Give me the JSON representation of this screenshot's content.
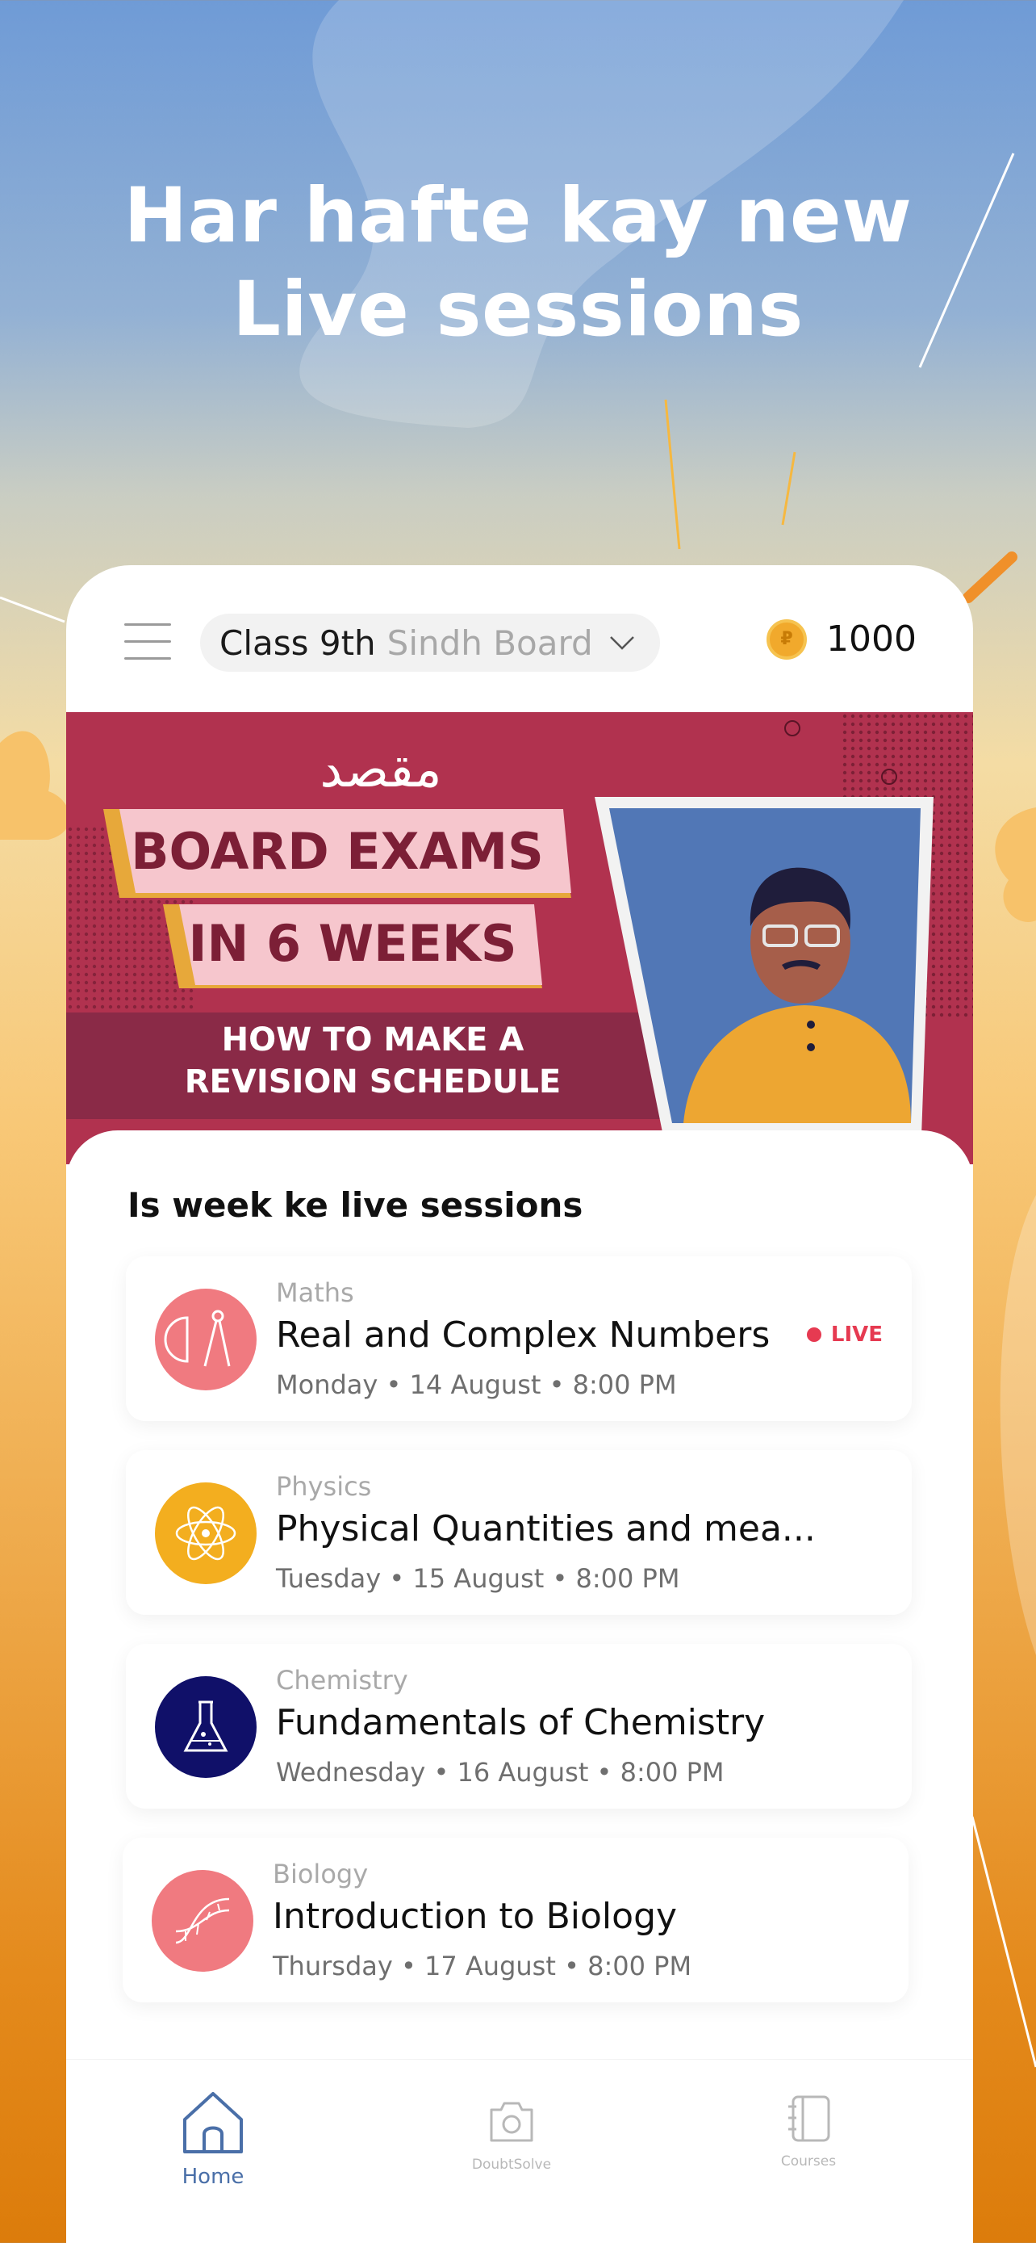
{
  "headline": {
    "line1": "Har hafte kay new",
    "line2": "Live sessions"
  },
  "header": {
    "class_label": "Class 9th",
    "board_label": "Sindh Board",
    "coin_count": "1000"
  },
  "banner": {
    "brand": "مقصد",
    "line1": "BOARD EXAMS",
    "line2": "IN 6 WEEKS",
    "sub1": "HOW TO MAKE A",
    "sub2": "REVISION SCHEDULE"
  },
  "sessions": {
    "section_title": "Is week ke live sessions",
    "items": [
      {
        "subject": "Maths",
        "title": "Real and Complex Numbers",
        "when": "Monday • 14 August • 8:00 PM",
        "live_label": "LIVE",
        "icon": "compass-protractor-icon",
        "color": "#f07a80"
      },
      {
        "subject": "Physics",
        "title": "Physical Quantities and mea...",
        "when": "Tuesday • 15 August • 8:00 PM",
        "icon": "atom-icon",
        "color": "#f3ae1f"
      },
      {
        "subject": "Chemistry",
        "title": "Fundamentals of Chemistry",
        "when": "Wednesday • 16 August • 8:00 PM",
        "icon": "flask-icon",
        "color": "#101069"
      },
      {
        "subject": "Biology",
        "title": "Introduction to Biology",
        "when": "Thursday • 17 August • 8:00 PM",
        "icon": "dna-icon",
        "color": "#f07a80"
      }
    ]
  },
  "tabbar": {
    "home": "Home",
    "doubtsolve": "DoubtSolve",
    "courses": "Courses",
    "active_color": "#4a6fa8",
    "inactive_color": "#b8b8b8"
  }
}
